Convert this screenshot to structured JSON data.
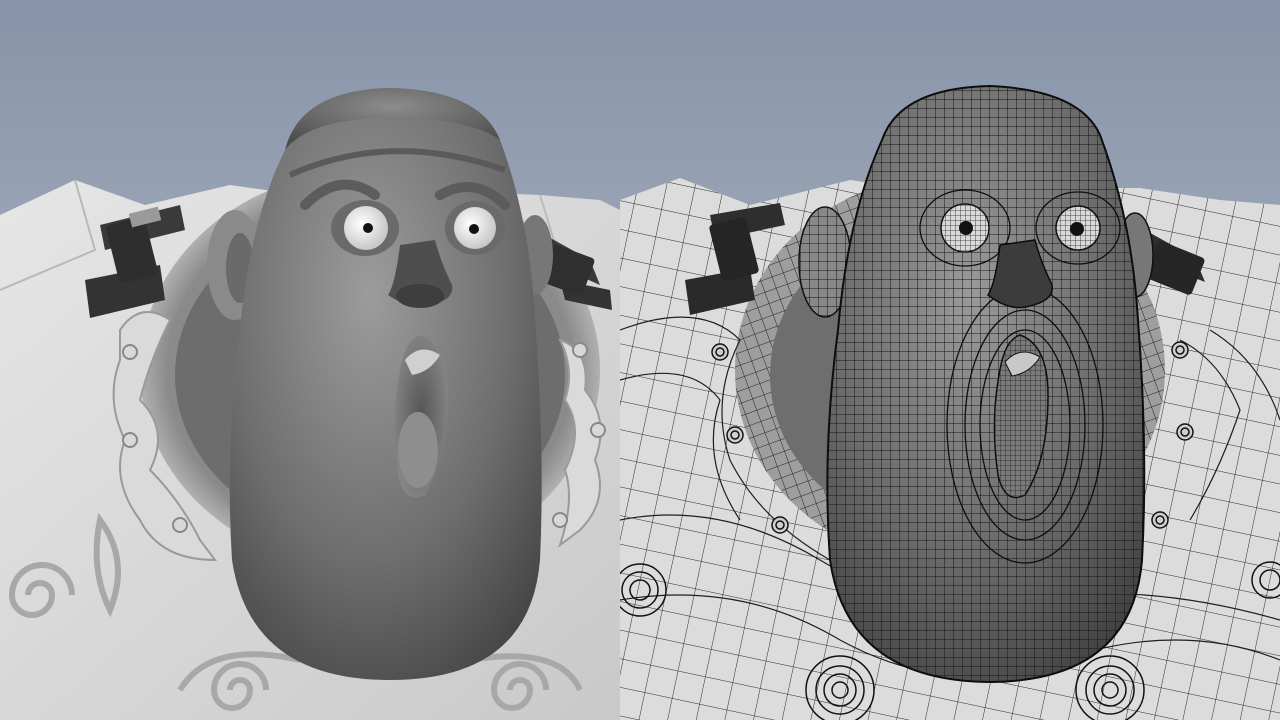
{
  "scene": {
    "viewports": [
      {
        "name": "smooth-shaded-view",
        "shading": "smooth"
      },
      {
        "name": "wireframe-on-shaded-view",
        "shading": "wireframe-on-shaded"
      }
    ],
    "colors": {
      "background_top": "#8793a8",
      "background_bottom": "#c4c9d0",
      "body_light": "#e2e2e2",
      "body_mid": "#c8c8c8",
      "head_light": "#9a9a9a",
      "head_dark": "#4a4a4a",
      "buckle": "#3a3a3a",
      "wire": "#1a1a1a"
    }
  }
}
